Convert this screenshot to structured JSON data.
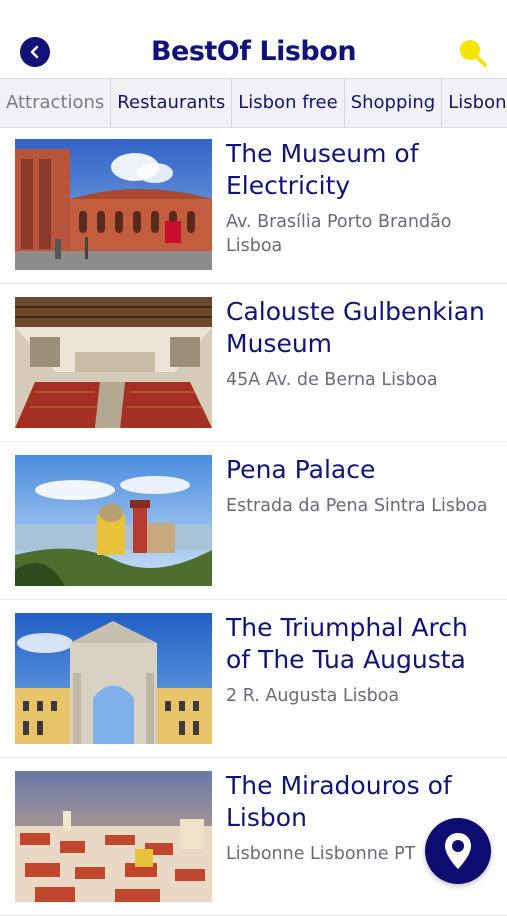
{
  "header": {
    "title": "BestOf Lisbon",
    "back_icon": "back-arrow-icon",
    "search_icon": "search-icon"
  },
  "tabs": [
    {
      "label": "Attractions"
    },
    {
      "label": "Restaurants"
    },
    {
      "label": "Lisbon free"
    },
    {
      "label": "Shopping"
    },
    {
      "label": "Lisbon w"
    }
  ],
  "places": [
    {
      "title": "The Museum of Electricity",
      "address": "Av. Brasília Porto Brandão Lisboa"
    },
    {
      "title": "Calouste Gulbenkian Museum",
      "address": "45A Av. de Berna Lisboa"
    },
    {
      "title": "Pena Palace",
      "address": "Estrada da Pena Sintra Lisboa"
    },
    {
      "title": " The Triumphal Arch of The Tua Augusta",
      "address": "2 R. Augusta Lisboa"
    },
    {
      "title": "The Miradouros of Lisbon",
      "address": "Lisbonne Lisbonne PT"
    }
  ],
  "fab": {
    "icon": "map-pin-icon"
  },
  "colors": {
    "primary": "#12127a",
    "accent": "#f5e400",
    "tab_bg": "#f1f1f5"
  }
}
